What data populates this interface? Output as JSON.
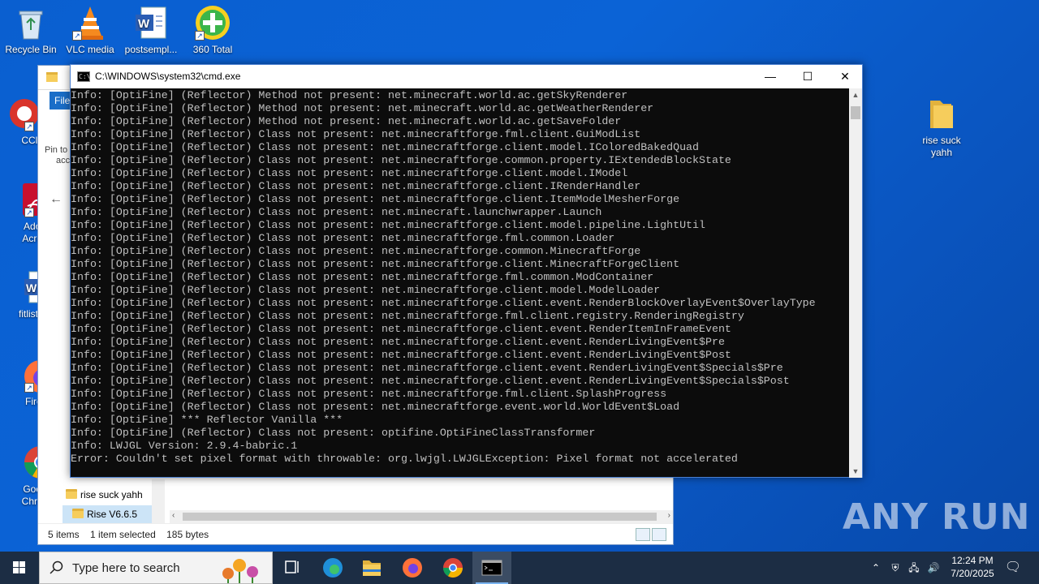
{
  "desktop": {
    "icons_top": [
      {
        "label": "Recycle Bin"
      },
      {
        "label": "VLC media"
      },
      {
        "label": "postsempl..."
      },
      {
        "label": "360 Total"
      }
    ],
    "icons_left": [
      {
        "label": "CClea"
      },
      {
        "label": "Adob"
      },
      {
        "label": "fitlisting"
      },
      {
        "label": "Firef"
      },
      {
        "label": "Goog"
      }
    ],
    "icons_left_line2": {
      "adobe": "Acrob",
      "chrome": "Chron"
    },
    "icon_right": {
      "label_line1": "rise suck",
      "label_line2": "yahh"
    }
  },
  "explorer": {
    "file_tab": "File",
    "pin_text_1": "Pin to",
    "pin_text_2": "acc",
    "nav_items": [
      {
        "label": "rise suck yahh"
      },
      {
        "label": "Rise V6.6.5"
      }
    ],
    "status": {
      "items": "5 items",
      "selected": "1 item selected",
      "size": "185 bytes"
    }
  },
  "cmd": {
    "title": "C:\\WINDOWS\\system32\\cmd.exe",
    "lines": [
      "Info: [OptiFine] (Reflector) Method not present: net.minecraft.world.ac.getSkyRenderer",
      "Info: [OptiFine] (Reflector) Method not present: net.minecraft.world.ac.getWeatherRenderer",
      "Info: [OptiFine] (Reflector) Method not present: net.minecraft.world.ac.getSaveFolder",
      "Info: [OptiFine] (Reflector) Class not present: net.minecraftforge.fml.client.GuiModList",
      "Info: [OptiFine] (Reflector) Class not present: net.minecraftforge.client.model.IColoredBakedQuad",
      "Info: [OptiFine] (Reflector) Class not present: net.minecraftforge.common.property.IExtendedBlockState",
      "Info: [OptiFine] (Reflector) Class not present: net.minecraftforge.client.model.IModel",
      "Info: [OptiFine] (Reflector) Class not present: net.minecraftforge.client.IRenderHandler",
      "Info: [OptiFine] (Reflector) Class not present: net.minecraftforge.client.ItemModelMesherForge",
      "Info: [OptiFine] (Reflector) Class not present: net.minecraft.launchwrapper.Launch",
      "Info: [OptiFine] (Reflector) Class not present: net.minecraftforge.client.model.pipeline.LightUtil",
      "Info: [OptiFine] (Reflector) Class not present: net.minecraftforge.fml.common.Loader",
      "Info: [OptiFine] (Reflector) Class not present: net.minecraftforge.common.MinecraftForge",
      "Info: [OptiFine] (Reflector) Class not present: net.minecraftforge.client.MinecraftForgeClient",
      "Info: [OptiFine] (Reflector) Class not present: net.minecraftforge.fml.common.ModContainer",
      "Info: [OptiFine] (Reflector) Class not present: net.minecraftforge.client.model.ModelLoader",
      "Info: [OptiFine] (Reflector) Class not present: net.minecraftforge.client.event.RenderBlockOverlayEvent$OverlayType",
      "Info: [OptiFine] (Reflector) Class not present: net.minecraftforge.fml.client.registry.RenderingRegistry",
      "Info: [OptiFine] (Reflector) Class not present: net.minecraftforge.client.event.RenderItemInFrameEvent",
      "Info: [OptiFine] (Reflector) Class not present: net.minecraftforge.client.event.RenderLivingEvent$Pre",
      "Info: [OptiFine] (Reflector) Class not present: net.minecraftforge.client.event.RenderLivingEvent$Post",
      "Info: [OptiFine] (Reflector) Class not present: net.minecraftforge.client.event.RenderLivingEvent$Specials$Pre",
      "Info: [OptiFine] (Reflector) Class not present: net.minecraftforge.client.event.RenderLivingEvent$Specials$Post",
      "Info: [OptiFine] (Reflector) Class not present: net.minecraftforge.fml.client.SplashProgress",
      "Info: [OptiFine] (Reflector) Class not present: net.minecraftforge.event.world.WorldEvent$Load",
      "Info: [OptiFine] *** Reflector Vanilla ***",
      "Info: [OptiFine] (Reflector) Class not present: optifine.OptiFineClassTransformer",
      "Info: LWJGL Version: 2.9.4-babric.1",
      "Error: Couldn't set pixel format with throwable: org.lwjgl.LWJGLException: Pixel format not accelerated"
    ]
  },
  "taskbar": {
    "search_placeholder": "Type here to search",
    "time": "12:24 PM",
    "date": "7/20/2025"
  },
  "watermark": "ANY RUN",
  "colors": {
    "desktop": "#0b63d6",
    "taskbar": "#1c2d44",
    "console_bg": "#0c0c0c",
    "console_text": "#c0c0c0"
  }
}
